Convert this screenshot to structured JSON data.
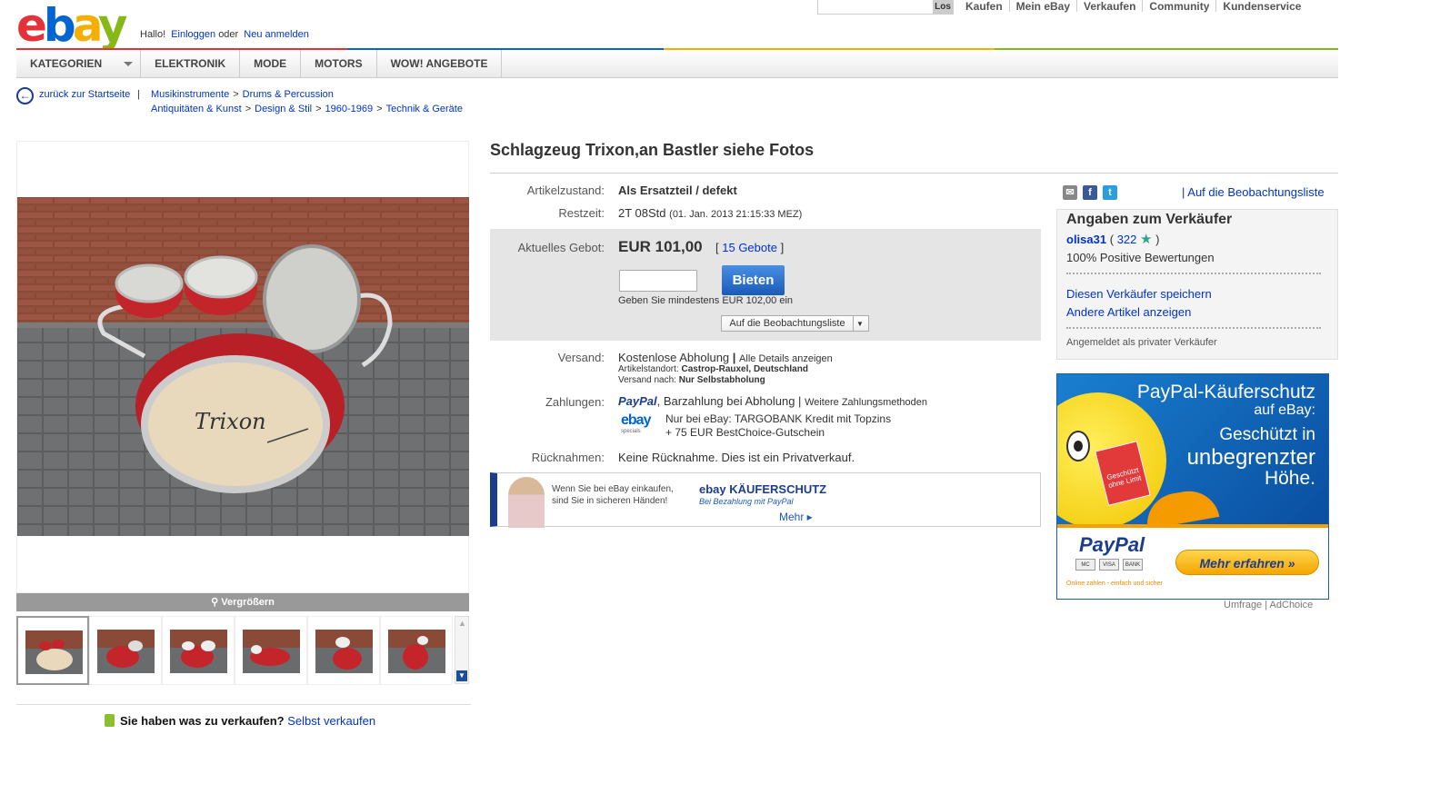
{
  "header": {
    "logo": "ebay",
    "greeting_prefix": "Hallo!",
    "login": "Einloggen",
    "or": "oder",
    "register": "Neu anmelden",
    "search_button": "Los",
    "nav": [
      "Kaufen",
      "Mein eBay",
      "Verkaufen",
      "Community",
      "Kundenservice"
    ]
  },
  "categories": {
    "main": "KATEGORIEN",
    "items": [
      "ELEKTRONIK",
      "MODE",
      "MOTORS",
      "WOW! ANGEBOTE"
    ]
  },
  "breadcrumb": {
    "back": "zurück zur Startseite",
    "sep": "|",
    "row1": [
      "Musikinstrumente",
      "Drums & Percussion"
    ],
    "row2": [
      "Antiquitäten & Kunst",
      "Design & Stil",
      "1960-1969",
      "Technik & Geräte"
    ],
    "arrow": ">"
  },
  "gallery": {
    "enlarge": "Vergrößern",
    "brand_on_drum": "Trixon"
  },
  "sell": {
    "question": "Sie haben was zu verkaufen?",
    "link": "Selbst verkaufen"
  },
  "item": {
    "title": "Schlagzeug Trixon,an Bastler siehe Fotos",
    "condition_label": "Artikelzustand:",
    "condition": "Als Ersatzteil / defekt",
    "time_label": "Restzeit:",
    "time_left": "2T 08Std",
    "time_end": "(01. Jan. 2013 21:15:33 MEZ)",
    "bid_label": "Aktuelles Gebot:",
    "bid_value": "EUR 101,00",
    "bids_open": "[",
    "bids_count": "15 Gebote",
    "bids_close": "]",
    "bid_button": "Bieten",
    "bid_hint": "Geben Sie mindestens EUR 102,00 ein",
    "watch_button": "Auf die Beobachtungsliste",
    "shipping_label": "Versand:",
    "shipping": "Kostenlose Abholung",
    "shipping_sep": "|",
    "shipping_details": "Alle Details anzeigen",
    "location_label": "Artikelstandort:",
    "location": "Castrop-Rauxel, Deutschland",
    "ships_to_label": "Versand nach:",
    "ships_to": "Nur Selbstabholung",
    "payment_label": "Zahlungen:",
    "paypal": "PayPal",
    "payment_text": ", Barzahlung bei Abholung |",
    "payment_more": "Weitere Zahlungsmethoden",
    "ebay_specials_logo": "ebay",
    "ebay_specials_sub": "specials",
    "promo_line1": "Nur bei eBay: TARGOBANK Kredit mit Topzins",
    "promo_line2": "+ 75 EUR BestChoice-Gutschein",
    "returns_label": "Rücknahmen:",
    "returns": "Keine Rücknahme. Dies ist ein Privatverkauf."
  },
  "ks_banner": {
    "text1": "Wenn Sie bei eBay einkaufen,",
    "text2": "sind Sie in sicheren Händen!",
    "logo": "ebay KÄUFERSCHUTZ",
    "sub": "Bei Bezahlung mit PayPal",
    "more": "Mehr ▸"
  },
  "seller": {
    "share_icons": [
      "email-icon",
      "facebook-icon",
      "twitter-icon"
    ],
    "watch_link": "| Auf die Beobachtungsliste",
    "title": "Angaben zum Verkäufer",
    "name": "olisa31",
    "score_open": "(",
    "score": "322",
    "score_close": ")",
    "positive": "100% Positive Bewertungen",
    "save": "Diesen Verkäufer speichern",
    "other": "Andere Artikel anzeigen",
    "type": "Angemeldet als privater Verkäufer"
  },
  "ad": {
    "h1": "PayPal-Käuferschutz",
    "h2": "auf eBay:",
    "h3": "Geschützt in",
    "h4": "unbegrenzter",
    "h5": "Höhe.",
    "box": "Geschützt ohne Limit",
    "logo": "PayPal",
    "cards": [
      "MC",
      "VISA",
      "BANK"
    ],
    "tagline": "Online zahlen - einfach und sicher",
    "cta": "Mehr erfahren »",
    "footer": "Umfrage | AdChoice"
  },
  "colors": {
    "ebay_red": "#e53238",
    "ebay_blue": "#0064d2",
    "ebay_yellow": "#f5af02",
    "ebay_green": "#86b817",
    "link": "#0033cc",
    "bid_button": "#1a5ab8"
  }
}
